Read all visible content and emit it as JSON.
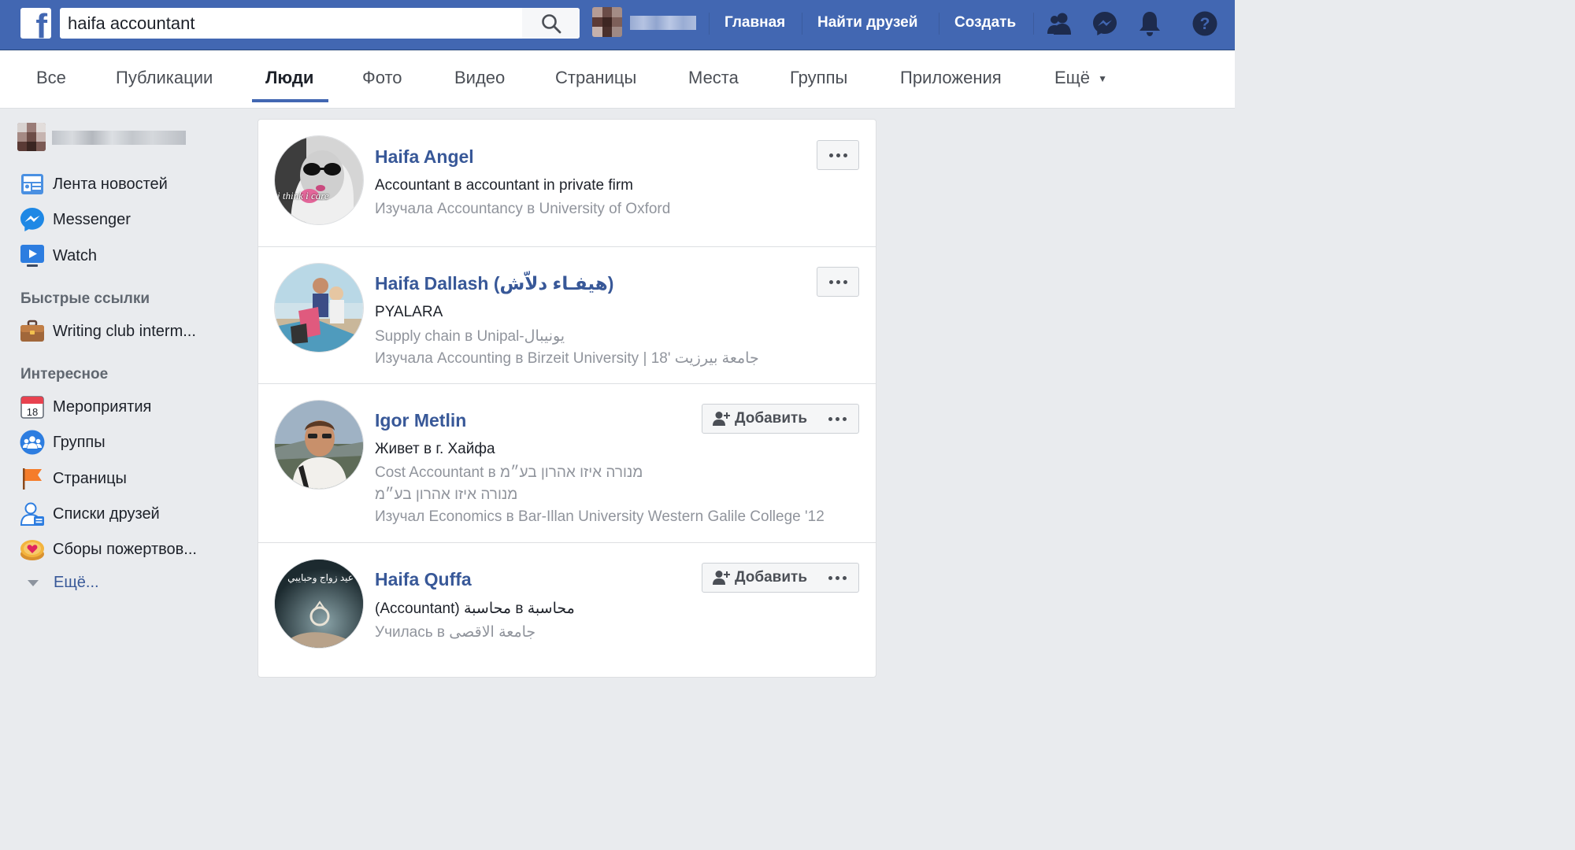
{
  "header": {
    "search_value": "haifa accountant",
    "nav": [
      "Главная",
      "Найти друзей",
      "Создать"
    ]
  },
  "tabs": [
    "Все",
    "Публикации",
    "Люди",
    "Фото",
    "Видео",
    "Страницы",
    "Места",
    "Группы",
    "Приложения",
    "Ещё"
  ],
  "active_tab": "Люди",
  "sidebar": {
    "items": [
      {
        "label": "Лента новостей",
        "icon": "news-feed-icon"
      },
      {
        "label": "Messenger",
        "icon": "messenger-icon"
      },
      {
        "label": "Watch",
        "icon": "watch-icon"
      }
    ],
    "quick_links_heading": "Быстрые ссылки",
    "quick_links": [
      {
        "label": "Writing club interm...",
        "icon": "briefcase-icon"
      }
    ],
    "explore_heading": "Интересное",
    "explore": [
      {
        "label": "Мероприятия",
        "icon": "calendar-icon",
        "badge": "18"
      },
      {
        "label": "Группы",
        "icon": "groups-icon"
      },
      {
        "label": "Страницы",
        "icon": "flag-icon"
      },
      {
        "label": "Списки друзей",
        "icon": "friend-lists-icon"
      },
      {
        "label": "Сборы пожертвов...",
        "icon": "fundraiser-icon"
      }
    ],
    "more_label": "Ещё..."
  },
  "results": [
    {
      "name": "Haifa Angel",
      "lines": [
        "Accountant в accountant in private firm",
        "Изучала Accountancy в University of Oxford"
      ],
      "avatar_text": "i think i care",
      "has_add": false
    },
    {
      "name": "Haifa Dallash (هيفـاء دلاّش)",
      "lines": [
        "PYALARA",
        "Supply chain в Unipal-يونيبال",
        "Изучала Accounting в Birzeit University | جامعة بيرزيت '18"
      ],
      "has_add": false
    },
    {
      "name": "Igor Metlin",
      "lines": [
        "Живет в г. Хайфа",
        "Cost Accountant в מנורה איזו אהרון בע״מ",
        "מנורה איזו אהרון בע״מ",
        "Изучал Economics в Bar-Illan University Western Galile College '12"
      ],
      "has_add": true
    },
    {
      "name": "Haifa Quffa",
      "lines": [
        "(Accountant) محاسبة в محاسبة",
        "Училась в جامعة الاقصى"
      ],
      "avatar_text": "عيد زواج وحبايبي",
      "has_add": true
    }
  ],
  "add_label": "Добавить",
  "colors": {
    "brand": "#4267b2",
    "link": "#385898",
    "muted": "#90949c"
  }
}
